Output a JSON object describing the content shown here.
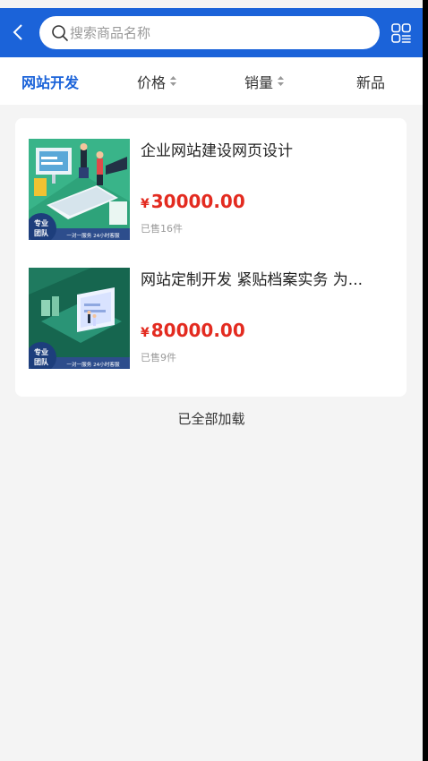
{
  "header": {
    "back_icon": "chevron-left-icon",
    "search_placeholder": "搜索商品名称",
    "search_value": "",
    "grid_icon": "grid-view-icon",
    "bar_color": "#1b63d9"
  },
  "filters": [
    {
      "label": "网站开发",
      "active": true
    },
    {
      "label": "价格",
      "sortable": true
    },
    {
      "label": "销量",
      "sortable": true
    },
    {
      "label": "新品"
    }
  ],
  "products": [
    {
      "title": "企业网站建设网页设计",
      "currency": "¥",
      "price": "30000.00",
      "sold": "已售16件",
      "badge": "专业\n团队",
      "banner": "一对一服务 24小时客服"
    },
    {
      "title": "网站定制开发 紧贴档案实务 为...",
      "currency": "¥",
      "price": "80000.00",
      "sold": "已售9件",
      "badge": "专业\n团队",
      "banner": "一对一服务 24小时客服"
    }
  ],
  "footer": {
    "all_loaded": "已全部加载"
  },
  "colors": {
    "accent": "#1b63d9",
    "price": "#e32b20",
    "background": "#f4f4f4"
  }
}
